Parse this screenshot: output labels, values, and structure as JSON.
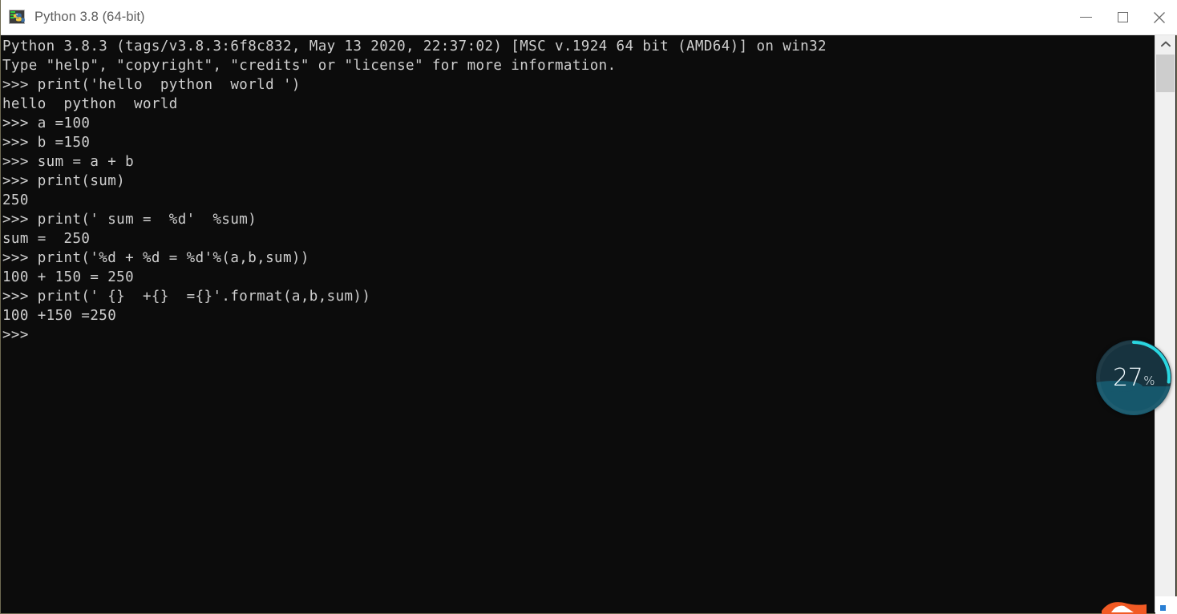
{
  "window": {
    "title": "Python 3.8 (64-bit)",
    "icon": "python-console-icon",
    "controls": {
      "minimize": "minimize-button",
      "maximize": "maximize-button",
      "close": "close-button"
    }
  },
  "console": {
    "background_color": "#0c0c0c",
    "text_color": "#cfcfcf",
    "prompt_color": "#c8b89a",
    "lines": [
      "Python 3.8.3 (tags/v3.8.3:6f8c832, May 13 2020, 22:37:02) [MSC v.1924 64 bit (AMD64)] on win32",
      "Type \"help\", \"copyright\", \"credits\" or \"license\" for more information.",
      ">>> print('hello  python  world ')",
      "hello  python  world",
      ">>> a =100",
      ">>> b =150",
      ">>> sum = a + b",
      ">>> print(sum)",
      "250",
      ">>> print(' sum =  %d'  %sum)",
      "sum =  250",
      ">>> print('%d + %d = %d'%(a,b,sum))",
      "100 + 150 = 250",
      ">>> print(' {}  +{}  ={}'.format(a,b,sum))",
      "100 +150 =250",
      ">>> "
    ],
    "full_text": "Python 3.8.3 (tags/v3.8.3:6f8c832, May 13 2020, 22:37:02) [MSC v.1924 64 bit (AMD64)] on win32\nType \"help\", \"copyright\", \"credits\" or \"license\" for more information.\n>>> print('hello  python  world ')\nhello  python  world\n>>> a =100\n>>> b =150\n>>> sum = a + b\n>>> print(sum)\n250\n>>> print(' sum =  %d'  %sum)\nsum =  250\n>>> print('%d + %d = %d'%(a,b,sum))\n100 + 150 = 250\n>>> print(' {}  +{}  ={}'.format(a,b,sum))\n100 +150 =250\n>>> "
  },
  "scrollbar": {
    "up_arrow": "scroll-up-arrow",
    "down_arrow": "scroll-down-arrow",
    "thumb": "scroll-thumb"
  },
  "monitor_widget": {
    "value": "27",
    "unit": "%",
    "percent": 27,
    "ring_color": "#2ad6e0",
    "body_color": "#17333f",
    "water_color": "#16576b"
  },
  "netspeed_panel": {
    "upload_icon": "upload-arrow-icon",
    "download_icon": "download-arrow-icon",
    "panel_color": "#3a4350"
  },
  "dock": {
    "icon": "orange-app-icon",
    "icon_color": "#f15a24"
  }
}
